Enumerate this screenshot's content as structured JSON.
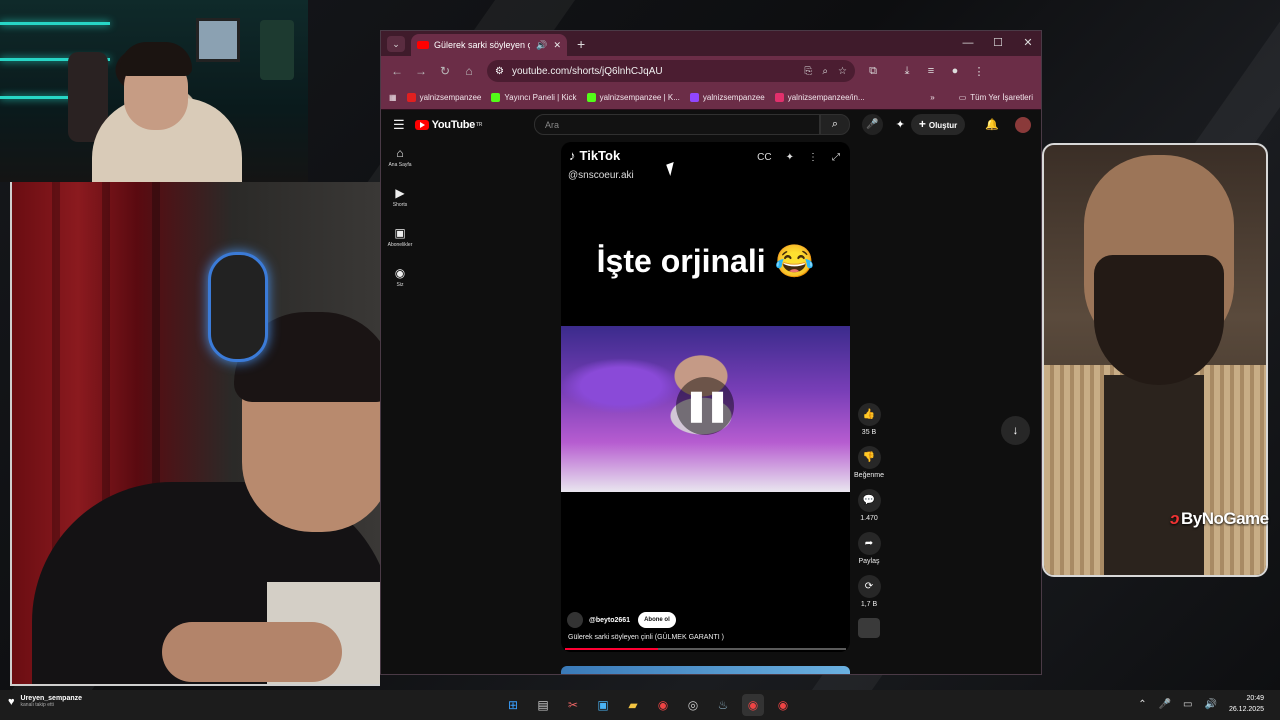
{
  "browser": {
    "tab_title": "Gülerek sarki söyleyen çinli",
    "url": "youtube.com/shorts/jQ6lnhCJqAU",
    "bookmarks": [
      {
        "label": "yalnizsempanzee",
        "color": "#e02020"
      },
      {
        "label": "Yayıncı Paneli | Kick",
        "color": "#53fc18"
      },
      {
        "label": "yalnizsempanzee | K...",
        "color": "#53fc18"
      },
      {
        "label": "yalnizsempanzee",
        "color": "#9146ff"
      },
      {
        "label": "yalnizsempanzee/in...",
        "color": "#e1306c"
      }
    ],
    "all_bookmarks_label": "Tüm Yer İşaretleri"
  },
  "youtube": {
    "logo_text": "YouTube",
    "logo_country": "TR",
    "search_placeholder": "Ara",
    "create_label": "Oluştur",
    "sidebar": [
      {
        "label": "Ana Sayfa",
        "icon": "home-icon"
      },
      {
        "label": "Shorts",
        "icon": "shorts-icon"
      },
      {
        "label": "Abonelikler",
        "icon": "subscriptions-icon"
      },
      {
        "label": "Siz",
        "icon": "you-icon"
      }
    ],
    "short": {
      "watermark": "TikTok",
      "tiktok_handle": "@snscoeur.aki",
      "caption": "İşte orjinali 😂",
      "channel": "@beyto2661",
      "subscribe_label": "Abone ol",
      "title": "Gülerek sarki söyleyen çinli (GÜLMEK GARANTI )",
      "progress": 0.33
    },
    "actions": {
      "likes": "35 B",
      "dislike_label": "Beğenme",
      "comments": "1.470",
      "share_label": "Paylaş",
      "remix": "1,7 B"
    }
  },
  "overlay": {
    "sponsor": "ByNoGame"
  },
  "taskbar": {
    "notification_user": "Ureyen_sempanze",
    "notification_text": "kanalı takip etti",
    "time": "20:49",
    "date": "26.12.2025"
  }
}
